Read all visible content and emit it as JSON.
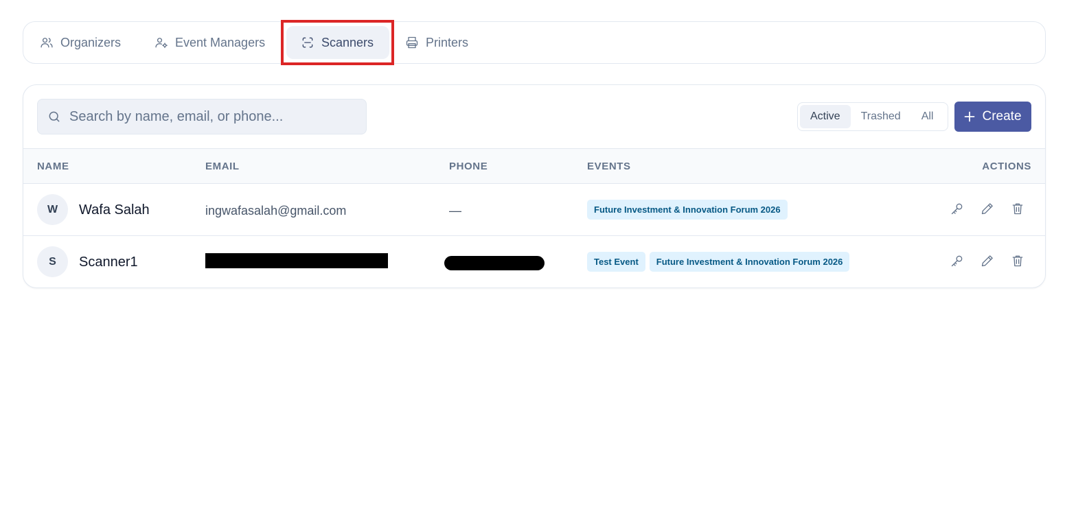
{
  "tabs": [
    {
      "label": "Organizers",
      "icon": "users-icon"
    },
    {
      "label": "Event Managers",
      "icon": "user-cog-icon"
    },
    {
      "label": "Scanners",
      "icon": "scan-icon",
      "active": true
    },
    {
      "label": "Printers",
      "icon": "printer-icon"
    }
  ],
  "search": {
    "placeholder": "Search by name, email, or phone..."
  },
  "filters": [
    {
      "label": "Active",
      "active": true
    },
    {
      "label": "Trashed"
    },
    {
      "label": "All"
    }
  ],
  "create_label": "Create",
  "columns": {
    "name": "NAME",
    "email": "EMAIL",
    "phone": "PHONE",
    "events": "EVENTS",
    "actions": "ACTIONS"
  },
  "rows": [
    {
      "initial": "W",
      "name": "Wafa Salah",
      "email": "ingwafasalah@gmail.com",
      "phone": "—",
      "events": [
        "Future Investment & Innovation Forum 2026"
      ]
    },
    {
      "initial": "S",
      "name": "Scanner1",
      "email": "",
      "phone": "",
      "email_redacted": true,
      "phone_redacted": true,
      "events": [
        "Test Event",
        "Future Investment & Innovation Forum 2026"
      ]
    }
  ],
  "colors": {
    "accent": "#4b5aa3",
    "badge_bg": "#e0f2fe",
    "badge_text": "#075985",
    "highlight": "#dc2626"
  }
}
